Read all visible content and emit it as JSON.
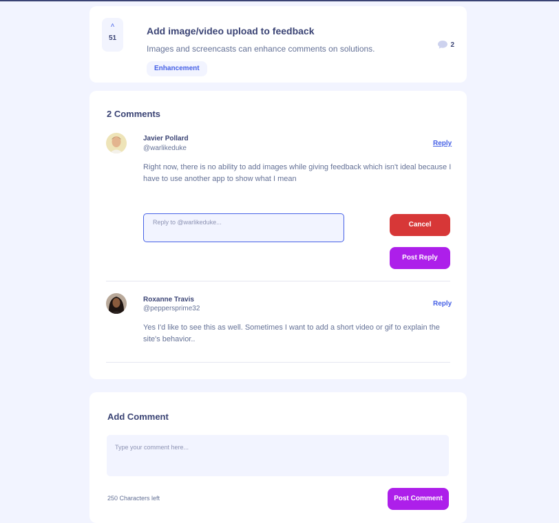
{
  "feedback": {
    "upvotes": "51",
    "title": "Add image/video upload to feedback",
    "description": "Images and screencasts can enhance comments on solutions.",
    "category": "Enhancement",
    "comment_count": "2"
  },
  "comments_section": {
    "heading": "2 Comments",
    "comments": [
      {
        "name": "Javier Pollard",
        "username": "@warlikeduke",
        "reply_label": "Reply",
        "text": "Right now, there is no ability to add images while giving feedback which isn't ideal because I have to use another app to show what I mean"
      },
      {
        "name": "Roxanne Travis",
        "username": "@peppersprime32",
        "reply_label": "Reply",
        "text": "Yes I'd like to see this as well. Sometimes I want to add a short video or gif to explain the site's behavior.."
      }
    ],
    "reply_form": {
      "placeholder": "Reply to @warlikeduke...",
      "cancel_label": "Cancel",
      "post_label": "Post Reply"
    }
  },
  "add_comment": {
    "heading": "Add Comment",
    "placeholder": "Type your comment here...",
    "chars_left": "250 Characters left",
    "post_label": "Post Comment"
  },
  "colors": {
    "page_bg": "#f2f4ff",
    "text_dark": "#3a4374",
    "text_muted": "#647196",
    "accent_blue": "#4661e6",
    "accent_purple": "#ad1fea",
    "danger_red": "#d73737"
  }
}
